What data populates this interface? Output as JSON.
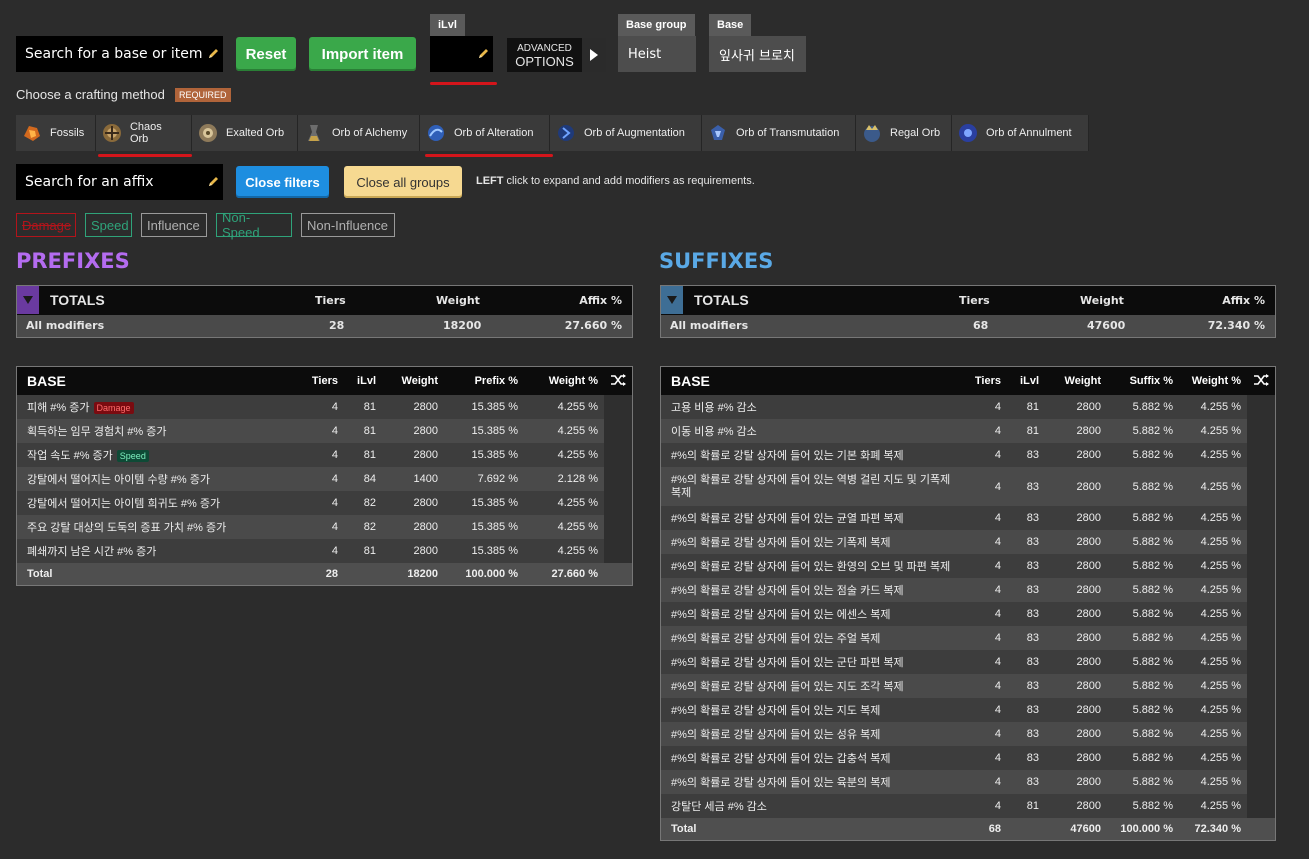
{
  "search_base": {
    "placeholder": "Search for a base or item"
  },
  "buttons": {
    "reset": "Reset",
    "import": "Import item",
    "close_filters": "Close filters",
    "close_groups": "Close all groups"
  },
  "ilvl": {
    "label": "iLvl",
    "value": ""
  },
  "advanced": {
    "line1": "ADVANCED",
    "line2": "OPTIONS"
  },
  "base_group": {
    "label": "Base group",
    "value": "Heist"
  },
  "base": {
    "label": "Base",
    "value": "잎사귀 브로치"
  },
  "crafting": {
    "label": "Choose a crafting method",
    "required": "REQUIRED"
  },
  "methods": [
    {
      "label": "Fossils",
      "icon": "fossil-icon"
    },
    {
      "label": "Chaos Orb",
      "icon": "chaos-orb-icon"
    },
    {
      "label": "Exalted Orb",
      "icon": "exalted-orb-icon"
    },
    {
      "label": "Orb of Alchemy",
      "icon": "alchemy-orb-icon"
    },
    {
      "label": "Orb of Alteration",
      "icon": "alteration-orb-icon"
    },
    {
      "label": "Orb of Augmentation",
      "icon": "augmentation-orb-icon"
    },
    {
      "label": "Orb of Transmutation",
      "icon": "transmutation-orb-icon"
    },
    {
      "label": "Regal Orb",
      "icon": "regal-orb-icon"
    },
    {
      "label": "Orb of Annulment",
      "icon": "annulment-orb-icon"
    }
  ],
  "search_affix": {
    "placeholder": "Search for an affix"
  },
  "hint": {
    "bold": "LEFT",
    "rest": " click to expand and add modifiers as requirements."
  },
  "filters": [
    {
      "label": "Damage",
      "color": "#b3141b"
    },
    {
      "label": "Speed",
      "color": "#2fa37a"
    },
    {
      "label": "Influence",
      "color": "#9a9a9a"
    },
    {
      "label": "Non-Speed",
      "color": "#2fa37a"
    },
    {
      "label": "Non-Influence",
      "color": "#9a9a9a"
    }
  ],
  "prefixes": {
    "title": "PREFIXES",
    "color": "#b46cf0",
    "totals": {
      "title": "TOTALS",
      "h1": "Tiers",
      "h2": "Weight",
      "h3": "Affix %",
      "row_label": "All modifiers",
      "tiers": "28",
      "weight": "18200",
      "affix": "27.660 %"
    },
    "base": {
      "title": "BASE",
      "headers": [
        "Tiers",
        "iLvl",
        "Weight",
        "Prefix %",
        "Weight %"
      ],
      "rows": [
        {
          "name": "피해 #% 증가",
          "tag": "Damage",
          "tiers": "4",
          "ilvl": "81",
          "weight": "2800",
          "pct": "15.385 %",
          "wpct": "4.255 %"
        },
        {
          "name": "획득하는 임무 경험치 #% 증가",
          "tiers": "4",
          "ilvl": "81",
          "weight": "2800",
          "pct": "15.385 %",
          "wpct": "4.255 %"
        },
        {
          "name": "작업 속도 #% 증가",
          "tag": "Speed",
          "tiers": "4",
          "ilvl": "81",
          "weight": "2800",
          "pct": "15.385 %",
          "wpct": "4.255 %"
        },
        {
          "name": "강탈에서 떨어지는 아이템 수량 #% 증가",
          "tiers": "4",
          "ilvl": "84",
          "weight": "1400",
          "pct": "7.692 %",
          "wpct": "2.128 %"
        },
        {
          "name": "강탈에서 떨어지는 아이템 희귀도 #% 증가",
          "tiers": "4",
          "ilvl": "82",
          "weight": "2800",
          "pct": "15.385 %",
          "wpct": "4.255 %"
        },
        {
          "name": "주요 강탈 대상의 도둑의 증표 가치 #% 증가",
          "tiers": "4",
          "ilvl": "82",
          "weight": "2800",
          "pct": "15.385 %",
          "wpct": "4.255 %"
        },
        {
          "name": "폐쇄까지 남은 시간 #% 증가",
          "tiers": "4",
          "ilvl": "81",
          "weight": "2800",
          "pct": "15.385 %",
          "wpct": "4.255 %"
        }
      ],
      "total": {
        "label": "Total",
        "tiers": "28",
        "weight": "18200",
        "pct": "100.000 %",
        "wpct": "27.660 %"
      }
    }
  },
  "suffixes": {
    "title": "SUFFIXES",
    "color": "#5aa9e6",
    "totals": {
      "title": "TOTALS",
      "h1": "Tiers",
      "h2": "Weight",
      "h3": "Affix %",
      "row_label": "All modifiers",
      "tiers": "68",
      "weight": "47600",
      "affix": "72.340 %"
    },
    "base": {
      "title": "BASE",
      "headers": [
        "Tiers",
        "iLvl",
        "Weight",
        "Suffix %",
        "Weight %"
      ],
      "rows": [
        {
          "name": "고용 비용 #% 감소",
          "tiers": "4",
          "ilvl": "81",
          "weight": "2800",
          "pct": "5.882 %",
          "wpct": "4.255 %"
        },
        {
          "name": "이동 비용 #% 감소",
          "tiers": "4",
          "ilvl": "81",
          "weight": "2800",
          "pct": "5.882 %",
          "wpct": "4.255 %"
        },
        {
          "name": "#%의 확률로 강탈 상자에 들어 있는 기본 화폐 복제",
          "tiers": "4",
          "ilvl": "83",
          "weight": "2800",
          "pct": "5.882 %",
          "wpct": "4.255 %"
        },
        {
          "name": "#%의 확률로 강탈 상자에 들어 있는 역병 걸린 지도 및 기폭제 복제",
          "tiers": "4",
          "ilvl": "83",
          "weight": "2800",
          "pct": "5.882 %",
          "wpct": "4.255 %",
          "tall": true
        },
        {
          "name": "#%의 확률로 강탈 상자에 들어 있는 균열 파편 복제",
          "tiers": "4",
          "ilvl": "83",
          "weight": "2800",
          "pct": "5.882 %",
          "wpct": "4.255 %"
        },
        {
          "name": "#%의 확률로 강탈 상자에 들어 있는 기폭제 복제",
          "tiers": "4",
          "ilvl": "83",
          "weight": "2800",
          "pct": "5.882 %",
          "wpct": "4.255 %"
        },
        {
          "name": "#%의 확률로 강탈 상자에 들어 있는 환영의 오브 및 파편 복제",
          "tiers": "4",
          "ilvl": "83",
          "weight": "2800",
          "pct": "5.882 %",
          "wpct": "4.255 %"
        },
        {
          "name": "#%의 확률로 강탈 상자에 들어 있는 점술 카드 복제",
          "tiers": "4",
          "ilvl": "83",
          "weight": "2800",
          "pct": "5.882 %",
          "wpct": "4.255 %"
        },
        {
          "name": "#%의 확률로 강탈 상자에 들어 있는 에센스 복제",
          "tiers": "4",
          "ilvl": "83",
          "weight": "2800",
          "pct": "5.882 %",
          "wpct": "4.255 %"
        },
        {
          "name": "#%의 확률로 강탈 상자에 들어 있는 주얼 복제",
          "tiers": "4",
          "ilvl": "83",
          "weight": "2800",
          "pct": "5.882 %",
          "wpct": "4.255 %"
        },
        {
          "name": "#%의 확률로 강탈 상자에 들어 있는 군단 파편 복제",
          "tiers": "4",
          "ilvl": "83",
          "weight": "2800",
          "pct": "5.882 %",
          "wpct": "4.255 %"
        },
        {
          "name": "#%의 확률로 강탈 상자에 들어 있는 지도 조각 복제",
          "tiers": "4",
          "ilvl": "83",
          "weight": "2800",
          "pct": "5.882 %",
          "wpct": "4.255 %"
        },
        {
          "name": "#%의 확률로 강탈 상자에 들어 있는 지도 복제",
          "tiers": "4",
          "ilvl": "83",
          "weight": "2800",
          "pct": "5.882 %",
          "wpct": "4.255 %"
        },
        {
          "name": "#%의 확률로 강탈 상자에 들어 있는 성유 복제",
          "tiers": "4",
          "ilvl": "83",
          "weight": "2800",
          "pct": "5.882 %",
          "wpct": "4.255 %"
        },
        {
          "name": "#%의 확률로 강탈 상자에 들어 있는 갑충석 복제",
          "tiers": "4",
          "ilvl": "83",
          "weight": "2800",
          "pct": "5.882 %",
          "wpct": "4.255 %"
        },
        {
          "name": "#%의 확률로 강탈 상자에 들어 있는 육분의 복제",
          "tiers": "4",
          "ilvl": "83",
          "weight": "2800",
          "pct": "5.882 %",
          "wpct": "4.255 %"
        },
        {
          "name": "강탈단 세금 #% 감소",
          "tiers": "4",
          "ilvl": "81",
          "weight": "2800",
          "pct": "5.882 %",
          "wpct": "4.255 %"
        }
      ],
      "total": {
        "label": "Total",
        "tiers": "68",
        "weight": "47600",
        "pct": "100.000 %",
        "wpct": "72.340 %"
      }
    }
  }
}
